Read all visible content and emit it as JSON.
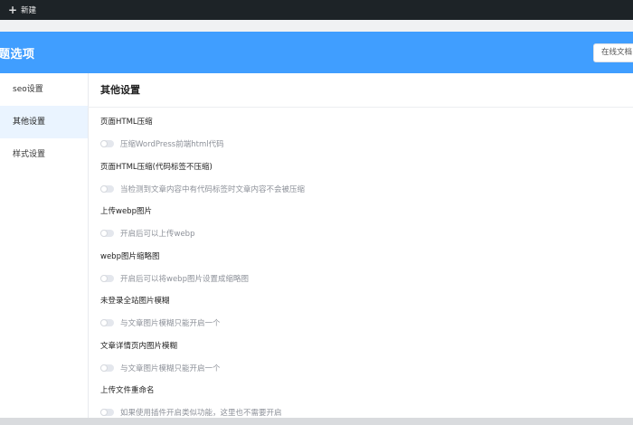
{
  "adminbar": {
    "plus_icon": "+",
    "new_label": "新建"
  },
  "header": {
    "title": "题选项",
    "doc_button": "在线文档"
  },
  "sidebar": {
    "items": [
      {
        "label": "seo设置",
        "active": false
      },
      {
        "label": "其他设置",
        "active": true
      },
      {
        "label": "样式设置",
        "active": false
      }
    ]
  },
  "main": {
    "section_title": "其他设置",
    "options": [
      {
        "label": "页面HTML压缩",
        "desc": "压缩WordPress前端html代码",
        "enabled": false
      },
      {
        "label": "页面HTML压缩(代码标签不压缩)",
        "desc": "当检测到文章内容中有代码标签时文章内容不会被压缩",
        "enabled": false
      },
      {
        "label": "上传webp图片",
        "desc": "开启后可以上传webp",
        "enabled": false
      },
      {
        "label": "webp图片缩略图",
        "desc": "开启后可以将webp图片设置成缩略图",
        "enabled": false
      },
      {
        "label": "未登录全站图片模糊",
        "desc": "与文章图片模糊只能开启一个",
        "enabled": false
      },
      {
        "label": "文章详情页内图片模糊",
        "desc": "与文章图片模糊只能开启一个",
        "enabled": false
      },
      {
        "label": "上传文件重命名",
        "desc": "如果使用插件开启类似功能，这里也不需要开启",
        "enabled": false
      }
    ]
  },
  "colors": {
    "header": "#409eff",
    "adminbar": "#1d2327",
    "active_item_bg": "#eaf4ff"
  }
}
